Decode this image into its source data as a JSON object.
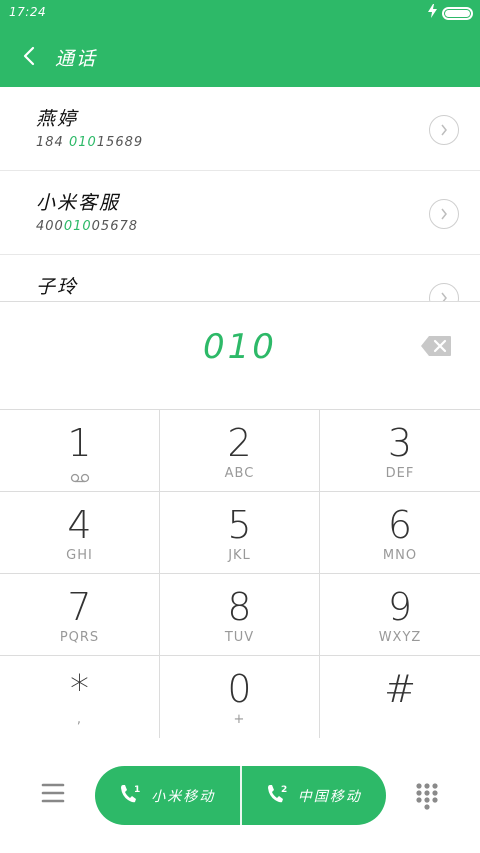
{
  "status_bar": {
    "time": "17:24",
    "battery_level": 1.0,
    "charging_icon": "bolt-icon"
  },
  "header": {
    "title": "通话",
    "back_icon": "chevron-left-icon"
  },
  "search_results": [
    {
      "name": "燕婷",
      "number_prefix": "184 ",
      "number_match": "010",
      "number_suffix": "15689"
    },
    {
      "name": "小米客服",
      "number_prefix": "400",
      "number_match": "010",
      "number_suffix": "05678"
    },
    {
      "name": "子玲",
      "number_prefix": "",
      "number_match": "",
      "number_suffix": ""
    }
  ],
  "dial": {
    "entered_digits": "010",
    "backspace_icon": "backspace-icon"
  },
  "keypad": [
    {
      "digit": "1",
      "letters": "",
      "sub_icon": "voicemail-icon"
    },
    {
      "digit": "2",
      "letters": "ABC"
    },
    {
      "digit": "3",
      "letters": "DEF"
    },
    {
      "digit": "4",
      "letters": "GHI"
    },
    {
      "digit": "5",
      "letters": "JKL"
    },
    {
      "digit": "6",
      "letters": "MNO"
    },
    {
      "digit": "7",
      "letters": "PQRS"
    },
    {
      "digit": "8",
      "letters": "TUV"
    },
    {
      "digit": "9",
      "letters": "WXYZ"
    },
    {
      "digit": "*",
      "letters": ","
    },
    {
      "digit": "0",
      "letters": "+"
    },
    {
      "digit": "#",
      "letters": ""
    }
  ],
  "call_buttons": [
    {
      "sim": "1",
      "label": "小米移动"
    },
    {
      "sim": "2",
      "label": "中国移动"
    }
  ],
  "colors": {
    "accent": "#2db968",
    "divider": "#dcdcdc",
    "muted_text": "#999999"
  }
}
